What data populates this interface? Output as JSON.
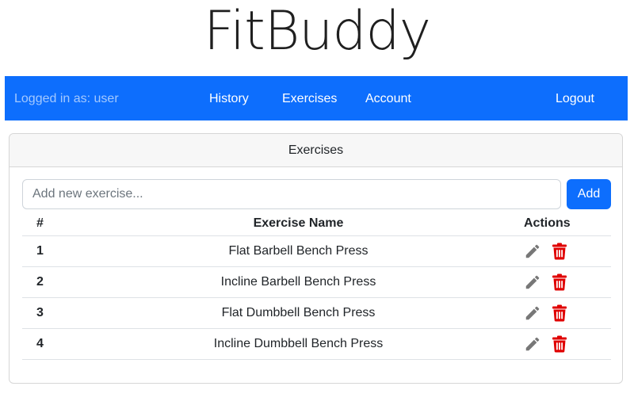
{
  "app": {
    "title": "FitBuddy"
  },
  "navbar": {
    "user_text": "Logged in as: user",
    "links": [
      "History",
      "Exercises",
      "Account"
    ],
    "logout": "Logout",
    "bg_color": "#0d6efd"
  },
  "card": {
    "header": "Exercises",
    "input": {
      "placeholder": "Add new exercise...",
      "value": ""
    },
    "add_button": "Add",
    "table": {
      "headers": [
        "#",
        "Exercise Name",
        "Actions"
      ],
      "rows": [
        {
          "num": "1",
          "name": "Flat Barbell Bench Press"
        },
        {
          "num": "2",
          "name": "Incline Barbell Bench Press"
        },
        {
          "num": "3",
          "name": "Flat Dumbbell Bench Press"
        },
        {
          "num": "4",
          "name": "Incline Dumbbell Bench Press"
        }
      ],
      "row_actions": [
        {
          "icon": "pencil-icon",
          "color": "#777777"
        },
        {
          "icon": "trash-icon",
          "color": "#e00000"
        }
      ]
    }
  }
}
